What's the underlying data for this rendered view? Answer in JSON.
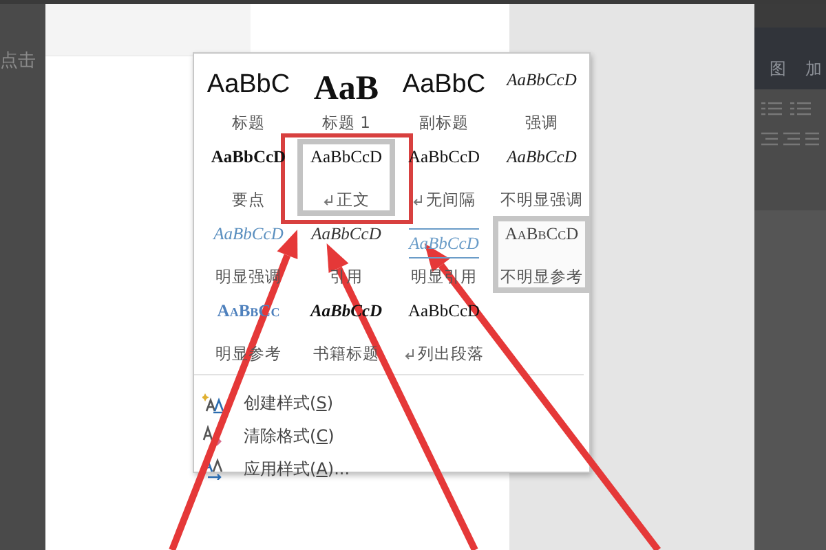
{
  "left_strip": {
    "text": "点击"
  },
  "ribbon": {
    "tabs": [
      "图",
      "加"
    ]
  },
  "styles_gallery": [
    {
      "sample": "AaBbC",
      "label": "标题",
      "kind": "title",
      "paragraph": false,
      "selected": false,
      "hovered": false,
      "framed": false,
      "arrow": false
    },
    {
      "sample": "AaB",
      "label": "标题 1",
      "kind": "heading",
      "paragraph": false,
      "selected": false,
      "hovered": false,
      "framed": false,
      "arrow": false
    },
    {
      "sample": "AaBbC",
      "label": "副标题",
      "kind": "subtitle",
      "paragraph": false,
      "selected": false,
      "hovered": false,
      "framed": false,
      "arrow": false
    },
    {
      "sample": "AaBbCcD",
      "label": "强调",
      "kind": "emphasis",
      "paragraph": false,
      "selected": false,
      "hovered": false,
      "framed": false,
      "arrow": false
    },
    {
      "sample": "AaBbCcD",
      "label": "要点",
      "kind": "strong",
      "paragraph": false,
      "selected": false,
      "hovered": false,
      "framed": false,
      "arrow": false
    },
    {
      "sample": "AaBbCcD",
      "label": "正文",
      "kind": "plain",
      "paragraph": true,
      "selected": true,
      "hovered": false,
      "framed": true,
      "arrow": true
    },
    {
      "sample": "AaBbCcD",
      "label": "无间隔",
      "kind": "plain",
      "paragraph": true,
      "selected": false,
      "hovered": false,
      "framed": false,
      "arrow": false
    },
    {
      "sample": "AaBbCcD",
      "label": "不明显强调",
      "kind": "emphasis",
      "paragraph": false,
      "selected": false,
      "hovered": false,
      "framed": false,
      "arrow": false
    },
    {
      "sample": "AaBbCcD",
      "label": "明显强调",
      "kind": "accent",
      "paragraph": false,
      "selected": false,
      "hovered": false,
      "framed": false,
      "arrow": false
    },
    {
      "sample": "AaBbCcD",
      "label": "引用",
      "kind": "quote",
      "paragraph": false,
      "selected": false,
      "hovered": false,
      "framed": false,
      "arrow": true
    },
    {
      "sample": "AaBbCcD",
      "label": "明显引用",
      "kind": "ruled",
      "paragraph": false,
      "selected": false,
      "hovered": false,
      "framed": false,
      "arrow": true
    },
    {
      "sample": "AaBbCcD",
      "label": "不明显参考",
      "kind": "smallcaps",
      "paragraph": false,
      "selected": false,
      "hovered": true,
      "framed": false,
      "arrow": false
    },
    {
      "sample": "AaBbCc",
      "label": "明显参考",
      "kind": "bold-smallcaps",
      "paragraph": false,
      "selected": false,
      "hovered": false,
      "framed": false,
      "arrow": false
    },
    {
      "sample": "AaBbCcD",
      "label": "书籍标题",
      "kind": "bold-italic",
      "paragraph": false,
      "selected": false,
      "hovered": false,
      "framed": false,
      "arrow": false
    },
    {
      "sample": "AaBbCcD",
      "label": "列出段落",
      "kind": "plain",
      "paragraph": true,
      "selected": false,
      "hovered": false,
      "framed": false,
      "arrow": false
    }
  ],
  "commands": [
    {
      "kind": "create",
      "before": "创建样式(",
      "key": "S",
      "after": ")"
    },
    {
      "kind": "clear",
      "before": "清除格式(",
      "key": "C",
      "after": ")"
    },
    {
      "kind": "apply",
      "before": "应用样式(",
      "key": "A",
      "after": ")..."
    }
  ]
}
